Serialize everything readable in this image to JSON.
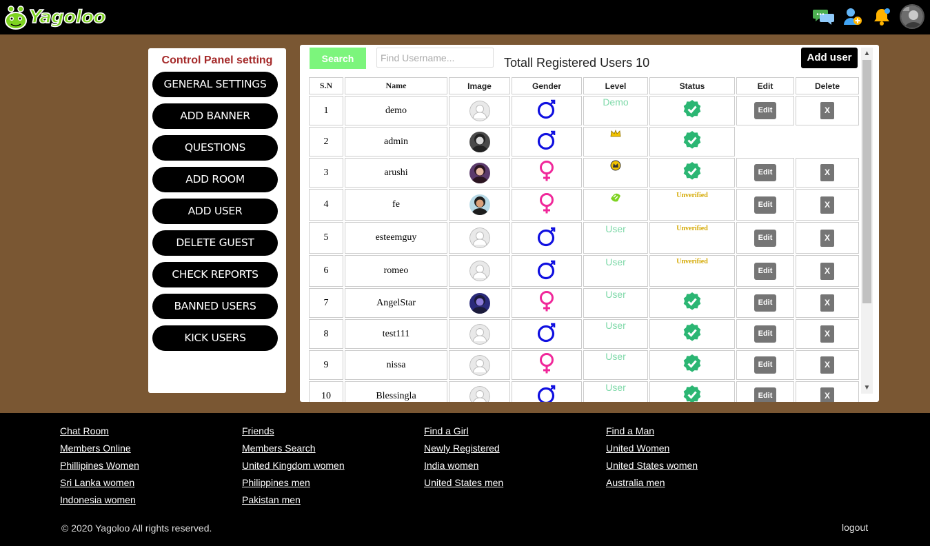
{
  "header": {
    "logo_text": "Yagoloo",
    "icons": [
      "chat-icon",
      "add-friend-icon",
      "notification-bell-icon",
      "user-avatar"
    ]
  },
  "sidebar": {
    "title": "Control Panel setting",
    "items": [
      {
        "label": "GENERAL SETTINGS"
      },
      {
        "label": "ADD BANNER"
      },
      {
        "label": "QUESTIONS"
      },
      {
        "label": "ADD ROOM"
      },
      {
        "label": "ADD USER"
      },
      {
        "label": "DELETE GUEST"
      },
      {
        "label": "CHECK REPORTS"
      },
      {
        "label": "BANNED USERS"
      },
      {
        "label": "KICK USERS"
      }
    ]
  },
  "main": {
    "search_label": "Search",
    "search_placeholder": "Find Username...",
    "total_text": "Totall Registered Users 10",
    "add_user_label": "Add user",
    "columns": [
      "S.N",
      "Name",
      "Image",
      "Gender",
      "Level",
      "Status",
      "Edit",
      "Delete"
    ],
    "edit_label": "Edit",
    "delete_label": "X",
    "unverified_label": "Unverified",
    "rows": [
      {
        "sn": "1",
        "name": "demo",
        "image": "default-avatar",
        "gender": "male",
        "level": "Demo",
        "level_icon": "",
        "status": "verified",
        "actions": true
      },
      {
        "sn": "2",
        "name": "admin",
        "image": "photo-avatar-admin",
        "gender": "male",
        "level": "",
        "level_icon": "crown-icon",
        "status": "verified",
        "actions": false
      },
      {
        "sn": "3",
        "name": "arushi",
        "image": "photo-avatar-arushi",
        "gender": "female",
        "level": "",
        "level_icon": "moderator-badge-icon",
        "status": "verified",
        "actions": true
      },
      {
        "sn": "4",
        "name": "fe",
        "image": "photo-avatar-fe",
        "gender": "female",
        "level": "",
        "level_icon": "vip-badge-icon",
        "status": "unverified",
        "actions": true
      },
      {
        "sn": "5",
        "name": "esteemguy",
        "image": "default-avatar-male",
        "gender": "male",
        "level": "User",
        "level_icon": "",
        "status": "unverified",
        "actions": true
      },
      {
        "sn": "6",
        "name": "romeo",
        "image": "default-avatar",
        "gender": "male",
        "level": "User",
        "level_icon": "",
        "status": "unverified",
        "actions": true
      },
      {
        "sn": "7",
        "name": "AngelStar",
        "image": "photo-avatar-angelstar",
        "gender": "female",
        "level": "User",
        "level_icon": "",
        "status": "verified",
        "actions": true
      },
      {
        "sn": "8",
        "name": "test111",
        "image": "default-avatar",
        "gender": "male",
        "level": "User",
        "level_icon": "",
        "status": "verified",
        "actions": true
      },
      {
        "sn": "9",
        "name": "nissa",
        "image": "default-avatar-female",
        "gender": "female",
        "level": "User",
        "level_icon": "",
        "status": "verified",
        "actions": true
      },
      {
        "sn": "10",
        "name": "Blessingla",
        "image": "default-avatar",
        "gender": "male",
        "level": "User",
        "level_icon": "",
        "status": "verified",
        "actions": true
      }
    ]
  },
  "footer": {
    "columns": [
      [
        "Chat Room",
        "Members Online",
        "Phillipines Women",
        "Sri Lanka women",
        "Indonesia women"
      ],
      [
        "Friends",
        "Members Search",
        "United Kingdom women",
        "Philippines men",
        "Pakistan men"
      ],
      [
        "Find a Girl",
        "Newly Registered",
        "India women",
        "United States men"
      ],
      [
        "Find a Man",
        "United Women",
        "United States women",
        "Australia men"
      ]
    ],
    "copyright": "© 2020 Yagoloo All rights reserved.",
    "logout": "logout"
  },
  "colors": {
    "background": "#7a5733",
    "male": "#1010e0",
    "female": "#f0289a",
    "verified": "#2bb673",
    "unverified": "#d4a800",
    "search_button": "#7cf57c",
    "sidebar_title": "#a52a2a"
  }
}
